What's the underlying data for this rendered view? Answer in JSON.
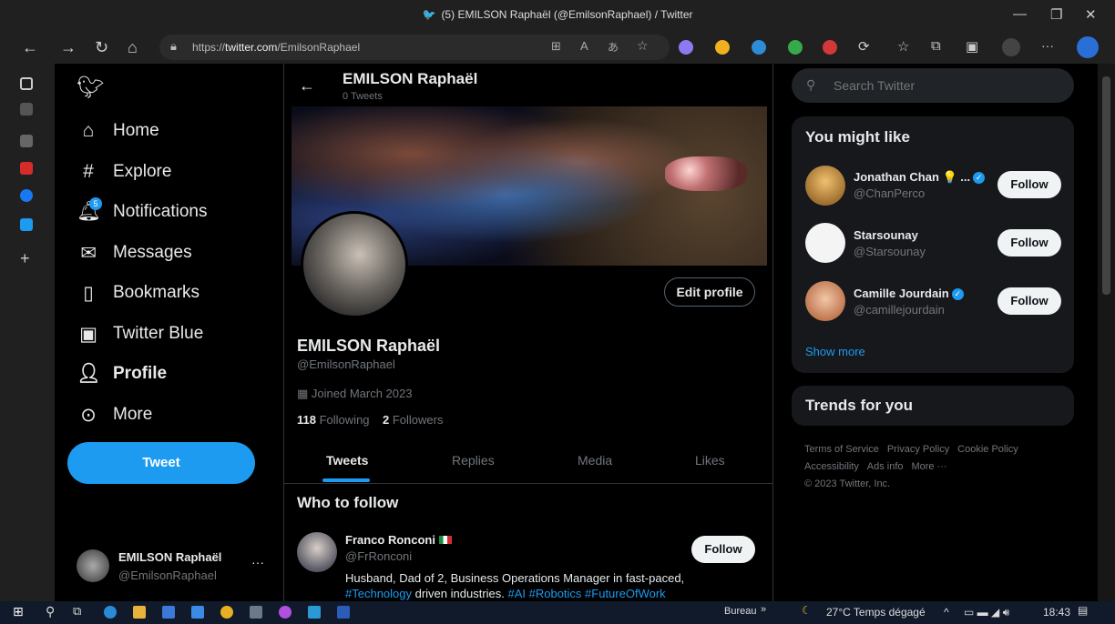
{
  "browser": {
    "title": "(5) EMILSON Raphaël (@EmilsonRaphael) / Twitter",
    "url_prefix": "https://",
    "url_domain": "twitter.com",
    "url_path": "/EmilsonRaphael"
  },
  "nav": {
    "home": "Home",
    "explore": "Explore",
    "notifications": "Notifications",
    "notifications_badge": "5",
    "messages": "Messages",
    "bookmarks": "Bookmarks",
    "twitter_blue": "Twitter Blue",
    "profile": "Profile",
    "more": "More",
    "tweet_button": "Tweet"
  },
  "account": {
    "name": "EMILSON Raphaël",
    "handle": "@EmilsonRaphael"
  },
  "profile_header": {
    "name": "EMILSON Raphaël",
    "tweet_count": "0 Tweets"
  },
  "profile": {
    "name": "EMILSON Raphaël",
    "handle": "@EmilsonRaphael",
    "joined": "Joined March 2023",
    "following_count": "118",
    "following_label": "Following",
    "followers_count": "2",
    "followers_label": "Followers",
    "edit_profile": "Edit profile"
  },
  "tabs": [
    "Tweets",
    "Replies",
    "Media",
    "Likes"
  ],
  "who_to_follow": {
    "title": "Who to follow",
    "user": {
      "name": "Franco Ronconi",
      "handle": "@FrRonconi",
      "bio_line1": "Husband, Dad of 2, Business Operations Manager in fast-paced,",
      "bio_tag1": "#Technology",
      "bio_mid": " driven industries. ",
      "bio_tag2": "#AI #Robotics #FutureOfWork",
      "follow": "Follow"
    }
  },
  "search": {
    "placeholder": "Search Twitter"
  },
  "you_might_like": {
    "title": "You might like",
    "users": [
      {
        "name": "Jonathan Chan 💡 ...",
        "handle": "@ChanPerco",
        "follow": "Follow"
      },
      {
        "name": "Starsounay",
        "handle": "@Starsounay",
        "follow": "Follow"
      },
      {
        "name": "Camille Jourdain",
        "handle": "@camillejourdain",
        "follow": "Follow"
      }
    ],
    "show_more": "Show more"
  },
  "trends": {
    "title": "Trends for you"
  },
  "footer": {
    "terms": "Terms of Service",
    "privacy": "Privacy Policy",
    "cookie": "Cookie Policy",
    "accessibility": "Accessibility",
    "ads": "Ads info",
    "more": "More ···",
    "copyright": "© 2023 Twitter, Inc."
  },
  "taskbar": {
    "bureau": "Bureau",
    "weather": "27°C  Temps dégagé",
    "time": "18:43"
  },
  "colors": {
    "accent": "#1d9bf0",
    "background": "#000000",
    "muted_text": "#71767b"
  }
}
